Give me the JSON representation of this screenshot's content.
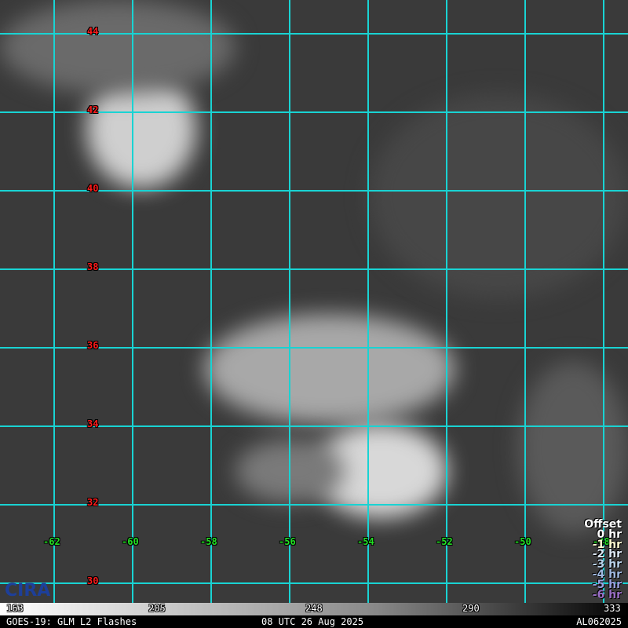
{
  "map": {
    "lat_labels": [
      "44",
      "42",
      "40",
      "38",
      "36",
      "34",
      "32",
      "30"
    ],
    "lon_labels": [
      "-62",
      "-60",
      "-58",
      "-56",
      "-54",
      "-52",
      "-50",
      "-48"
    ],
    "grid_color": "#19d3d3"
  },
  "legend": {
    "title": "Offset",
    "items": [
      {
        "label": "0 hr",
        "color": "#ffffff"
      },
      {
        "label": "-1 hr",
        "color": "#fffad0"
      },
      {
        "label": "-2 hr",
        "color": "#dde8f5"
      },
      {
        "label": "-3 hr",
        "color": "#b9d2ea"
      },
      {
        "label": "-4 hr",
        "color": "#9fb8e0"
      },
      {
        "label": "-5 hr",
        "color": "#9a9fe0"
      },
      {
        "label": "-6 hr",
        "color": "#9a6fc6"
      }
    ]
  },
  "colorbar": {
    "ticks": [
      "163",
      "205",
      "248",
      "290",
      "333"
    ]
  },
  "footer": {
    "left": "GOES-19: GLM L2 Flashes",
    "center": "08 UTC 26 Aug 2025",
    "right": "AL062025"
  },
  "logo": "CIRA"
}
